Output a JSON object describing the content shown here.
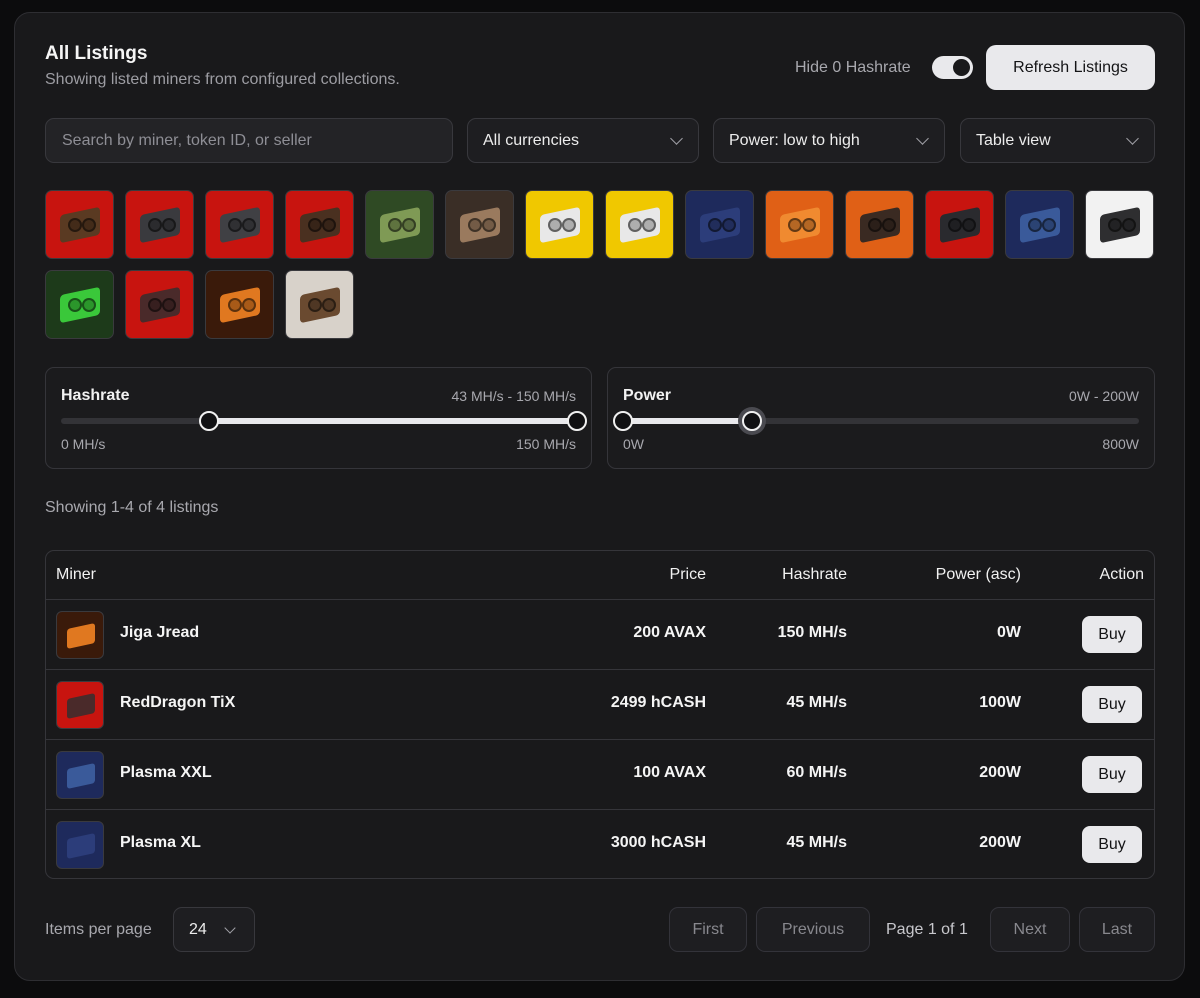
{
  "header": {
    "title": "All Listings",
    "subtitle": "Showing listed miners from configured collections.",
    "hide_zero_label": "Hide 0 Hashrate",
    "hide_zero_enabled": true,
    "refresh_label": "Refresh Listings"
  },
  "filters": {
    "search_placeholder": "Search by miner, token ID, or seller",
    "currency": "All currencies",
    "sort": "Power: low to high",
    "view": "Table view"
  },
  "collections": [
    {
      "icon": "miner-red-3d-icon",
      "bg": "#c8140f",
      "fg": "#5a3a22"
    },
    {
      "icon": "gpu-red-icon",
      "bg": "#c8140f",
      "fg": "#3a3a3e"
    },
    {
      "icon": "gpu-red-dual-icon",
      "bg": "#c8140f",
      "fg": "#404044"
    },
    {
      "icon": "miner-rig-red-icon",
      "bg": "#c8140f",
      "fg": "#4a3020"
    },
    {
      "icon": "toad-icon",
      "bg": "#2f4a24",
      "fg": "#7f9a55"
    },
    {
      "icon": "toad-brown-icon",
      "bg": "#3a2e26",
      "fg": "#9a7a5e"
    },
    {
      "icon": "gpu-yellow-icon",
      "bg": "#f0c800",
      "fg": "#e8e8e8"
    },
    {
      "icon": "gpu-yellow-dual-icon",
      "bg": "#f0c800",
      "fg": "#e8e8e8"
    },
    {
      "icon": "gpu-blue-icon",
      "bg": "#1e2a5c",
      "fg": "#2c3d7a"
    },
    {
      "icon": "usb-miner-orange-icon",
      "bg": "#e06016",
      "fg": "#f08a30"
    },
    {
      "icon": "hub-orange-icon",
      "bg": "#e06016",
      "fg": "#3a2a22"
    },
    {
      "icon": "rig-red-star-icon",
      "bg": "#c8140f",
      "fg": "#2a2a2e"
    },
    {
      "icon": "gpu-blue-dual-icon",
      "bg": "#1e2a5c",
      "fg": "#3a5a9a"
    },
    {
      "icon": "box-white-icon",
      "bg": "#f2f2f2",
      "fg": "#2e2e30"
    },
    {
      "icon": "miner-green-icon",
      "bg": "#1d3a1a",
      "fg": "#3ac83a"
    },
    {
      "icon": "gpu-red-triple-icon",
      "bg": "#c8140f",
      "fg": "#4a2a2a"
    },
    {
      "icon": "fire-toad-icon",
      "bg": "#3a1a0a",
      "fg": "#e07820"
    },
    {
      "icon": "wood-bundle-icon",
      "bg": "#d8d2ca",
      "fg": "#6a4a30"
    }
  ],
  "hashrate": {
    "label": "Hashrate",
    "selected": "43 MH/s - 150 MH/s",
    "min_label": "0 MH/s",
    "max_label": "150 MH/s",
    "min": 0,
    "max": 150,
    "low": 43,
    "high": 150
  },
  "power": {
    "label": "Power",
    "selected": "0W - 200W",
    "min_label": "0W",
    "max_label": "800W",
    "min": 0,
    "max": 800,
    "low": 0,
    "high": 200
  },
  "results_text": "Showing 1-4 of 4 listings",
  "table": {
    "headers": {
      "miner": "Miner",
      "price": "Price",
      "hashrate": "Hashrate",
      "power": "Power (asc)",
      "action": "Action"
    },
    "rows": [
      {
        "name": "Jiga Jread",
        "price": "200 AVAX",
        "hashrate": "150 MH/s",
        "power": "0W",
        "action": "Buy",
        "thumb_bg": "#3a1a0a",
        "thumb_fg": "#e07820"
      },
      {
        "name": "RedDragon TiX",
        "price": "2499 hCASH",
        "hashrate": "45 MH/s",
        "power": "100W",
        "action": "Buy",
        "thumb_bg": "#c8140f",
        "thumb_fg": "#4a2a2a"
      },
      {
        "name": "Plasma XXL",
        "price": "100 AVAX",
        "hashrate": "60 MH/s",
        "power": "200W",
        "action": "Buy",
        "thumb_bg": "#1e2a5c",
        "thumb_fg": "#3a5a9a"
      },
      {
        "name": "Plasma XL",
        "price": "3000 hCASH",
        "hashrate": "45 MH/s",
        "power": "200W",
        "action": "Buy",
        "thumb_bg": "#1e2a5c",
        "thumb_fg": "#2c3d7a"
      }
    ]
  },
  "pagination": {
    "items_per_page_label": "Items per page",
    "items_per_page": "24",
    "first": "First",
    "previous": "Previous",
    "page_info": "Page 1 of 1",
    "next": "Next",
    "last": "Last"
  }
}
